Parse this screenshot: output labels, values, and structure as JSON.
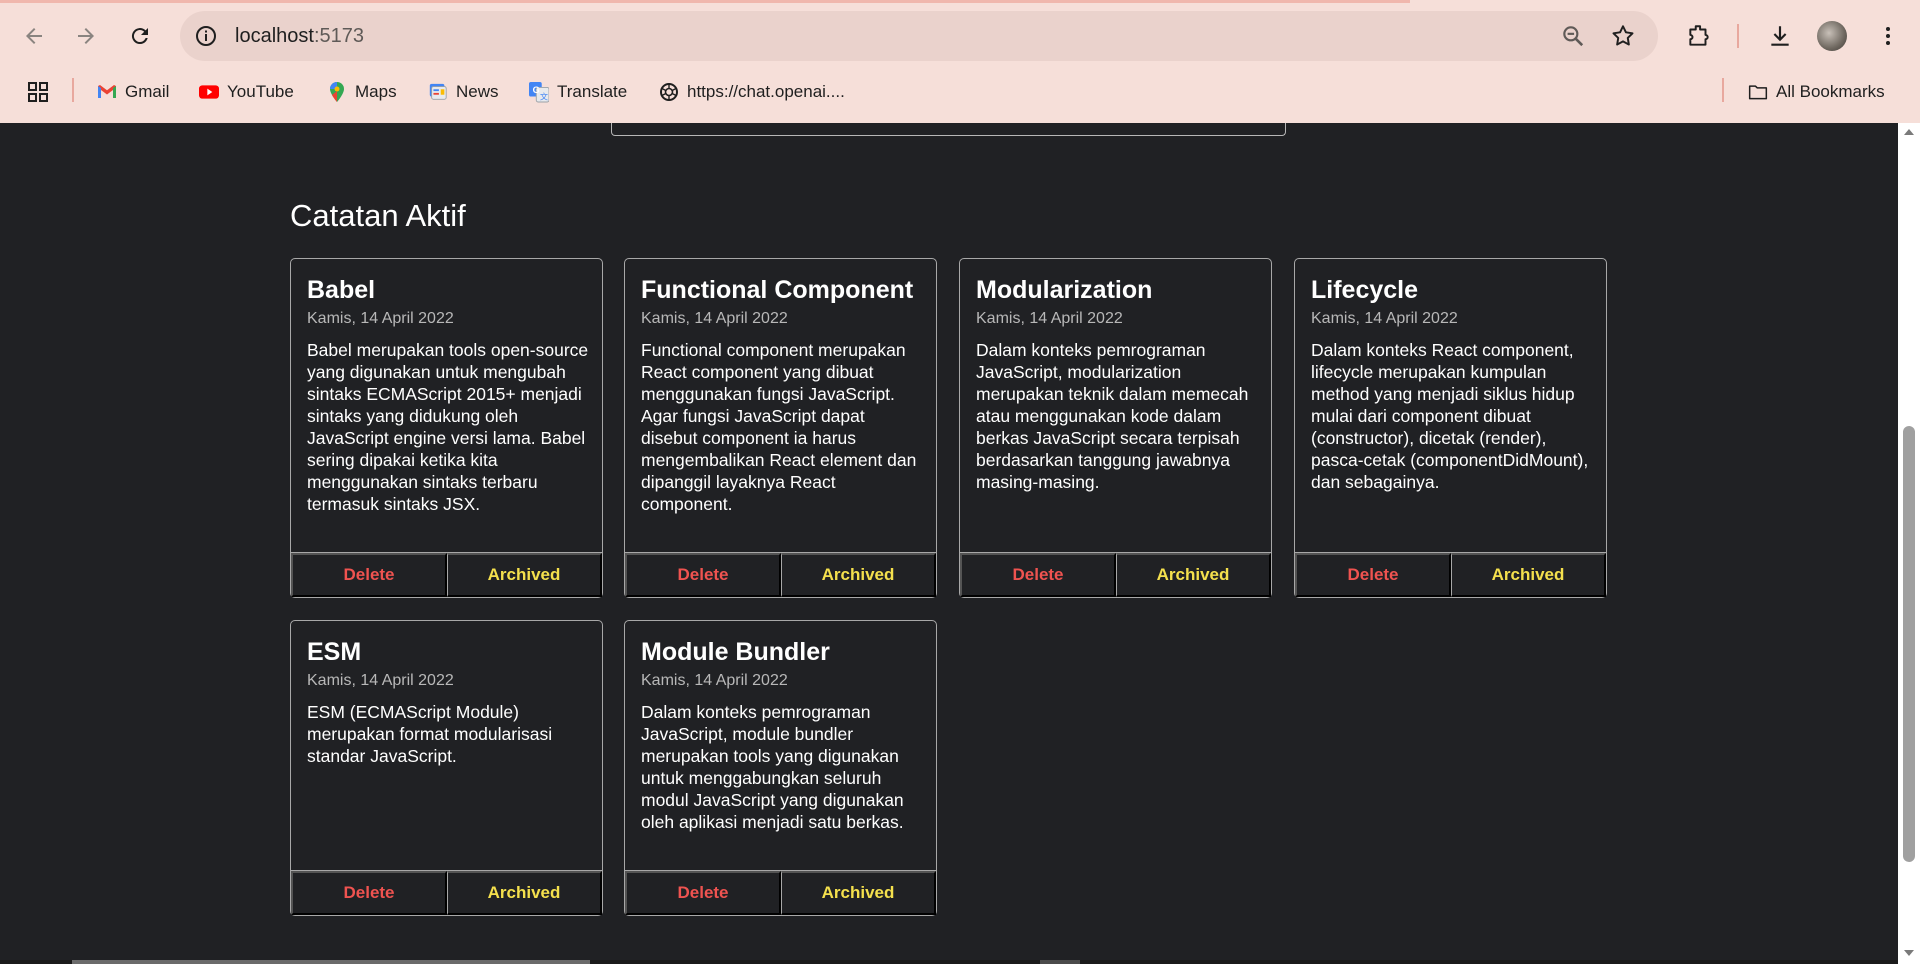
{
  "browser": {
    "url_host": "localhost",
    "url_port": ":5173",
    "bookmarks": [
      {
        "label": "Gmail",
        "icon": "gmail-icon"
      },
      {
        "label": "YouTube",
        "icon": "youtube-icon"
      },
      {
        "label": "Maps",
        "icon": "maps-icon"
      },
      {
        "label": "News",
        "icon": "news-icon"
      },
      {
        "label": "Translate",
        "icon": "translate-icon"
      },
      {
        "label": "https://chat.openai....",
        "icon": "openai-icon"
      }
    ],
    "all_bookmarks": "All Bookmarks"
  },
  "page": {
    "section_title": "Catatan Aktif",
    "delete_label": "Delete",
    "archive_label": "Archived",
    "notes": [
      {
        "title": "Babel",
        "date": "Kamis, 14 April 2022",
        "body": "Babel merupakan tools open-source yang digunakan untuk mengubah sintaks ECMAScript 2015+ menjadi sintaks yang didukung oleh JavaScript engine versi lama. Babel sering dipakai ketika kita menggunakan sintaks terbaru termasuk sintaks JSX."
      },
      {
        "title": "Functional Component",
        "date": "Kamis, 14 April 2022",
        "body": "Functional component merupakan React component yang dibuat menggunakan fungsi JavaScript. Agar fungsi JavaScript dapat disebut component ia harus mengembalikan React element dan dipanggil layaknya React component."
      },
      {
        "title": "Modularization",
        "date": "Kamis, 14 April 2022",
        "body": "Dalam konteks pemrograman JavaScript, modularization merupakan teknik dalam memecah atau menggunakan kode dalam berkas JavaScript secara terpisah berdasarkan tanggung jawabnya masing-masing."
      },
      {
        "title": "Lifecycle",
        "date": "Kamis, 14 April 2022",
        "body": "Dalam konteks React component, lifecycle merupakan kumpulan method yang menjadi siklus hidup mulai dari component dibuat (constructor), dicetak (render), pasca-cetak (componentDidMount), dan sebagainya."
      },
      {
        "title": "ESM",
        "date": "Kamis, 14 April 2022",
        "body": "ESM (ECMAScript Module) merupakan format modularisasi standar JavaScript."
      },
      {
        "title": "Module Bundler",
        "date": "Kamis, 14 April 2022",
        "body": "Dalam konteks pemrograman JavaScript, module bundler merupakan tools yang digunakan untuk menggabungkan seluruh modul JavaScript yang digunakan oleh aplikasi menjadi satu berkas."
      }
    ]
  }
}
